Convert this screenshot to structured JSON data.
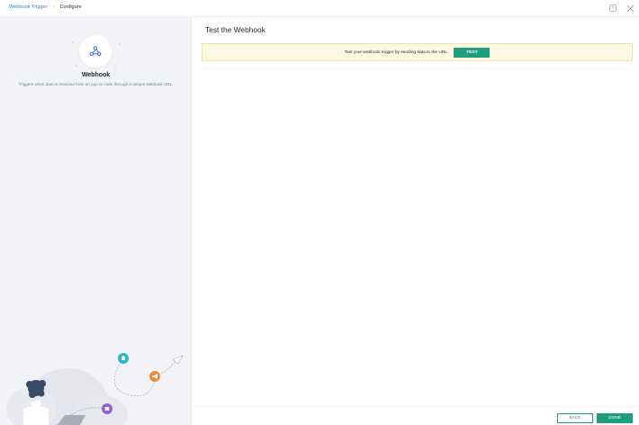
{
  "breadcrumb": {
    "items": [
      {
        "label": "Webhook Trigger"
      },
      {
        "label": "Configure"
      }
    ],
    "separator": "›"
  },
  "header": {
    "help_icon": "help-square-icon",
    "close_icon": "close-x-icon"
  },
  "left_panel": {
    "app_icon": "webhook-icon",
    "app_name": "Webhook",
    "app_description": "Triggers when data is received from an app or code through a unique webhook URL."
  },
  "main": {
    "title": "Test the Webhook",
    "banner": {
      "text": "Test your webhook trigger by sending data to the URL.",
      "button_label": "TEST"
    }
  },
  "footer": {
    "back_label": "BACK",
    "done_label": "DONE"
  },
  "colors": {
    "accent": "#1e9e7d",
    "link": "#3b82c4",
    "banner_bg": "#fdf8e1",
    "left_panel_bg": "#f2f3f6"
  }
}
